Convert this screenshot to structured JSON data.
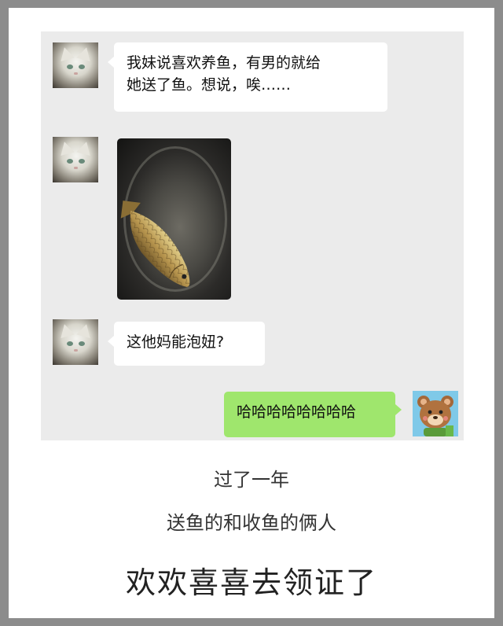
{
  "chat": {
    "messages": [
      {
        "side": "left",
        "sender_avatar": "white-cat-avatar",
        "type": "text",
        "text": "我妹说喜欢养鱼，有男的就给她送了鱼。想说，唉……",
        "line1": "我妹说喜欢养鱼，有男的就给",
        "line2": "她送了鱼。想说，唉……"
      },
      {
        "side": "left",
        "sender_avatar": "white-cat-avatar",
        "type": "image",
        "image_subject": "carp-fish-in-basin"
      },
      {
        "side": "left",
        "sender_avatar": "white-cat-avatar",
        "type": "text",
        "text": "这他妈能泡妞?"
      },
      {
        "side": "right",
        "sender_avatar": "cartoon-bear-avatar",
        "type": "text",
        "text": "哈哈哈哈哈哈哈哈"
      }
    ],
    "colors": {
      "background": "#ebebeb",
      "incoming_bubble": "#ffffff",
      "outgoing_bubble": "#9fe66d"
    }
  },
  "captions": {
    "line1": "过了一年",
    "line2": "送鱼的和收鱼的俩人",
    "line3": "欢欢喜喜去领证了"
  },
  "frame": {
    "border_color": "#8c8c8c"
  }
}
